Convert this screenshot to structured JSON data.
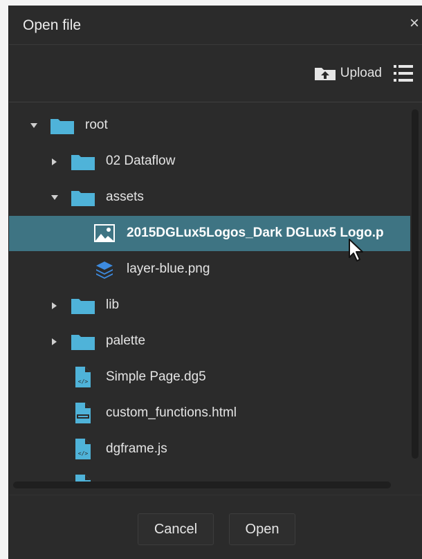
{
  "dialog": {
    "title": "Open file",
    "close_glyph": "×"
  },
  "toolbar": {
    "upload_label": "Upload",
    "upload_icon": "folder-upload-icon",
    "menu_icon": "list-menu-icon"
  },
  "tree": {
    "items": [
      {
        "label": "root",
        "type": "folder",
        "state": "expanded"
      },
      {
        "label": "02 Dataflow",
        "type": "folder",
        "state": "collapsed"
      },
      {
        "label": "assets",
        "type": "folder",
        "state": "expanded"
      },
      {
        "label": "2015DGLux5Logos_Dark DGLux5 Logo.p",
        "type": "image",
        "selected": true
      },
      {
        "label": "layer-blue.png",
        "type": "layers"
      },
      {
        "label": "lib",
        "type": "folder",
        "state": "collapsed"
      },
      {
        "label": "palette",
        "type": "folder",
        "state": "collapsed"
      },
      {
        "label": "Simple Page.dg5",
        "type": "code-file"
      },
      {
        "label": "custom_functions.html",
        "type": "html-file"
      },
      {
        "label": "dgframe.js",
        "type": "code-file"
      }
    ]
  },
  "buttons": {
    "cancel": "Cancel",
    "open": "Open"
  },
  "colors": {
    "dialog_bg": "#2b2b2b",
    "selected_row": "#3e7483",
    "folder": "#4fb3d9",
    "layers": "#3d8be0"
  }
}
